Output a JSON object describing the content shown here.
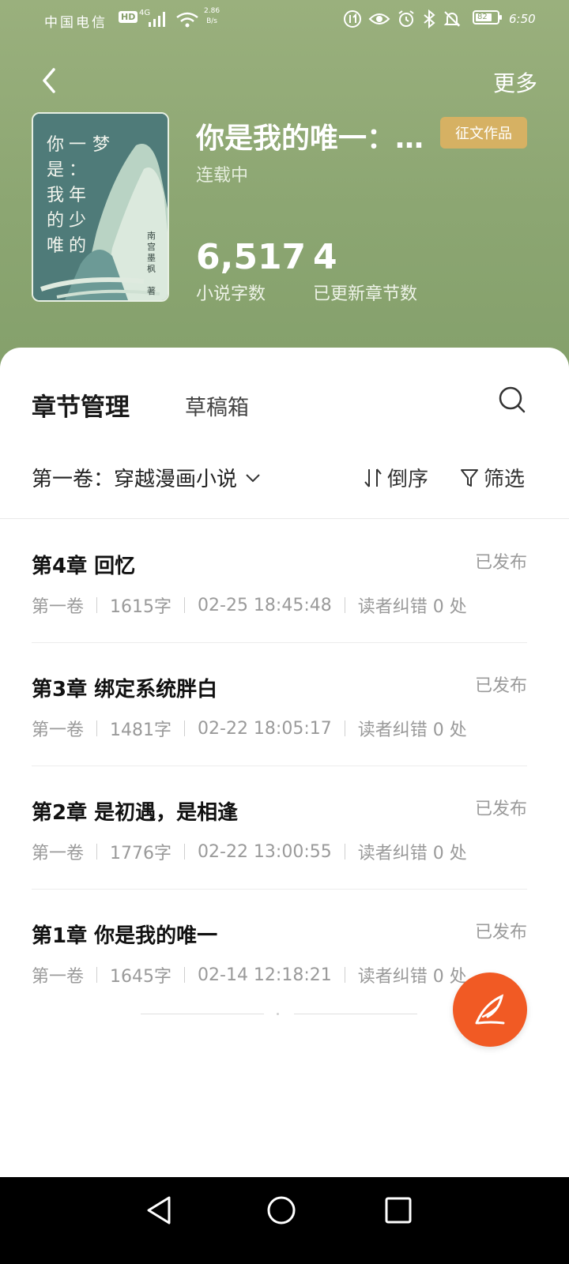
{
  "status_bar": {
    "carrier": "中国电信",
    "hd": "HD",
    "network": "4G",
    "speed_value": "2.86",
    "speed_unit": "B/s",
    "battery": "82",
    "time": "6:50"
  },
  "header": {
    "more_label": "更多",
    "book_title": "你是我的唯一：…",
    "badge": "征文作品",
    "serial_status": "连载中",
    "word_count": "6,517",
    "word_count_label": "小说字数",
    "chapter_count": "4",
    "chapter_count_label": "已更新章节数"
  },
  "cover": {
    "columns": [
      "梦一你",
      "年：是",
      "少我年",
      "的的少",
      "唯的"
    ],
    "col1": "你是我的唯",
    "col2": "一：年少的",
    "col3": "梦",
    "author": "南宫墨枫",
    "author_suffix": "著"
  },
  "tabs": {
    "active": "章节管理",
    "drafts": "草稿箱"
  },
  "toolbar": {
    "volume": "第一卷：穿越漫画小说",
    "sort": "倒序",
    "filter": "筛选"
  },
  "chapters": [
    {
      "title": "第4章 回忆",
      "status": "已发布",
      "volume": "第一卷",
      "words": "1615字",
      "time": "02-25 18:45:48",
      "errata": "读者纠错 0 处"
    },
    {
      "title": "第3章 绑定系统胖白",
      "status": "已发布",
      "volume": "第一卷",
      "words": "1481字",
      "time": "02-22 18:05:17",
      "errata": "读者纠错 0 处"
    },
    {
      "title": "第2章 是初遇，是相逢",
      "status": "已发布",
      "volume": "第一卷",
      "words": "1776字",
      "time": "02-22 13:00:55",
      "errata": "读者纠错 0 处"
    },
    {
      "title": "第1章 你是我的唯一",
      "status": "已发布",
      "volume": "第一卷",
      "words": "1645字",
      "time": "02-14 12:18:21",
      "errata": "读者纠错 0 处"
    }
  ],
  "colors": {
    "header_green": "#8ca672",
    "badge_gold": "#d6b163",
    "fab_orange": "#f15a24"
  },
  "icons": {
    "back": "chevron-left-icon",
    "search": "search-icon",
    "sort": "sort-icon",
    "filter": "filter-icon",
    "fab": "quill-pen-icon"
  }
}
